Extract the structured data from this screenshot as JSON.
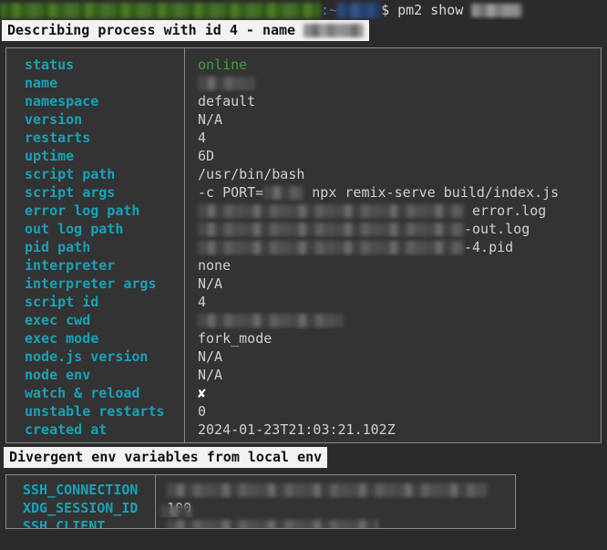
{
  "terminal": {
    "prompt": {
      "user_host_redacted": true,
      "user_host_width": 352,
      "separator": ":~",
      "path_redacted": true,
      "path_width": 48,
      "dollar": "$",
      "command": "pm2 show",
      "command_arg_redacted": true,
      "command_arg_width": 56
    },
    "header_bar": {
      "text_prefix": "Describing process with id 4 - name ",
      "name_redacted": true,
      "name_width": 66
    },
    "section_bar": {
      "text": "Divergent env variables from local env"
    }
  },
  "colors": {
    "background": "#2b2b2b",
    "panel": "#333333",
    "border": "#8a8a8a",
    "label": "#17a2b8",
    "value": "#d0d0d0",
    "status_online": "#3fa33f",
    "prompt_blue": "#4f7fd0",
    "invert_bg": "#f2f2f2"
  },
  "process_table": {
    "rows": [
      {
        "label": "status",
        "value": "online",
        "style": "green"
      },
      {
        "label": "name",
        "value": "",
        "style": "redacted",
        "redact_width": 62
      },
      {
        "label": "namespace",
        "value": "default",
        "style": "plain"
      },
      {
        "label": "version",
        "value": "N/A",
        "style": "plain"
      },
      {
        "label": "restarts",
        "value": "4",
        "style": "plain"
      },
      {
        "label": "uptime",
        "value": "6D",
        "style": "plain"
      },
      {
        "label": "script path",
        "value": "/usr/bin/bash",
        "style": "plain"
      },
      {
        "label": "script args",
        "value": "-c PORT=█ npx remix-serve build/index.js",
        "style": "args",
        "prefix": "-c PORT=",
        "redact_width": 44,
        "suffix": " npx remix-serve build/index.js"
      },
      {
        "label": "error log path",
        "value": "█ error.log",
        "style": "path",
        "redact_width": 292,
        "suffix": " error.log"
      },
      {
        "label": "out log path",
        "value": "█-out.log",
        "style": "path",
        "redact_width": 292,
        "suffix": "-out.log"
      },
      {
        "label": "pid path",
        "value": "█-4.pid",
        "style": "path",
        "redact_width": 292,
        "suffix": "-4.pid"
      },
      {
        "label": "interpreter",
        "value": "none",
        "style": "plain"
      },
      {
        "label": "interpreter args",
        "value": "N/A",
        "style": "plain"
      },
      {
        "label": "script id",
        "value": "4",
        "style": "plain"
      },
      {
        "label": "exec cwd",
        "value": "",
        "style": "redacted",
        "redact_width": 160
      },
      {
        "label": "exec mode",
        "value": "fork_mode",
        "style": "plain"
      },
      {
        "label": "node.js version",
        "value": "N/A",
        "style": "plain"
      },
      {
        "label": "node env",
        "value": "N/A",
        "style": "plain"
      },
      {
        "label": "watch & reload",
        "value": "✘",
        "style": "xmark"
      },
      {
        "label": "unstable restarts",
        "value": "0",
        "style": "plain"
      },
      {
        "label": "created at",
        "value": "2024-01-23T21:03:21.102Z",
        "style": "plain"
      }
    ]
  },
  "env_table": {
    "rows": [
      {
        "label": "SSH_CONNECTION",
        "value": "",
        "style": "redacted",
        "redact_width": 352
      },
      {
        "label": "XDG_SESSION_ID",
        "value": "100",
        "style": "partial",
        "redact_width": 34
      },
      {
        "label": "SSH_CLIENT",
        "value": "",
        "style": "redacted",
        "redact_width": 232
      }
    ]
  }
}
